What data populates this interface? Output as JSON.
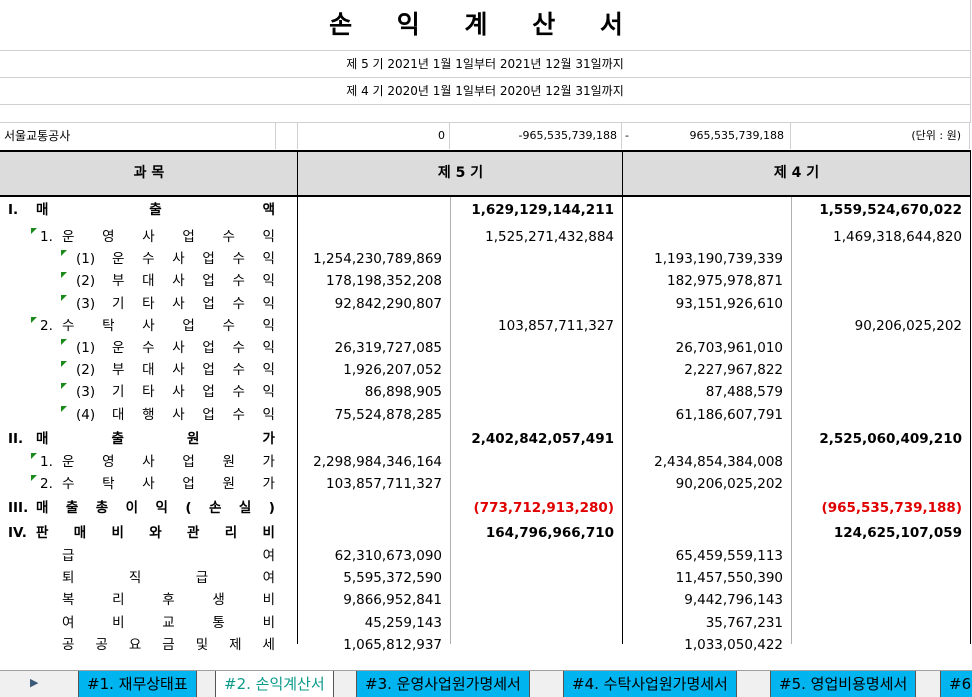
{
  "title": "손 익 계 산 서",
  "period_current": "제 5 기   2021년 1월 1일부터 2021년 12월 31일까지",
  "period_prior": "제 4 기   2020년 1월 1일부터 2020년 12월 31일까지",
  "info": {
    "company": "서울교통공사",
    "val1": "0",
    "val2": "-965,535,739,188",
    "dash": "-",
    "val3": "965,535,739,188",
    "unit": "(단위 : 원)"
  },
  "header": {
    "subject": "과          목",
    "current": "제 5 기",
    "prior": "제 4 기"
  },
  "rows": [
    {
      "num": "I.",
      "label": "매출액",
      "c1": "",
      "c2": "1,629,129,144,211",
      "c3": "",
      "c4": "1,559,524,670,022",
      "major": true
    },
    {
      "num": "1.",
      "label": "운영사업수익",
      "c1": "",
      "c2": "1,525,271,432,884",
      "c3": "",
      "c4": "1,469,318,644,820",
      "ind": 1
    },
    {
      "num": "(1)",
      "label": "운수사업수익",
      "c1": "1,254,230,789,869",
      "c2": "",
      "c3": "1,193,190,739,339",
      "c4": "",
      "ind": 2
    },
    {
      "num": "(2)",
      "label": "부대사업수익",
      "c1": "178,198,352,208",
      "c2": "",
      "c3": "182,975,978,871",
      "c4": "",
      "ind": 2
    },
    {
      "num": "(3)",
      "label": "기타사업수익",
      "c1": "92,842,290,807",
      "c2": "",
      "c3": "93,151,926,610",
      "c4": "",
      "ind": 2
    },
    {
      "num": "2.",
      "label": "수탁사업수익",
      "c1": "",
      "c2": "103,857,711,327",
      "c3": "",
      "c4": "90,206,025,202",
      "ind": 1
    },
    {
      "num": "(1)",
      "label": "운수사업수익",
      "c1": "26,319,727,085",
      "c2": "",
      "c3": "26,703,961,010",
      "c4": "",
      "ind": 2
    },
    {
      "num": "(2)",
      "label": "부대사업수익",
      "c1": "1,926,207,052",
      "c2": "",
      "c3": "2,227,967,822",
      "c4": "",
      "ind": 2
    },
    {
      "num": "(3)",
      "label": "기타사업수익",
      "c1": "86,898,905",
      "c2": "",
      "c3": "87,488,579",
      "c4": "",
      "ind": 2
    },
    {
      "num": "(4)",
      "label": "대행사업수익",
      "c1": "75,524,878,285",
      "c2": "",
      "c3": "61,186,607,791",
      "c4": "",
      "ind": 2
    },
    {
      "num": "II.",
      "label": "매출원가",
      "c1": "",
      "c2": "2,402,842,057,491",
      "c3": "",
      "c4": "2,525,060,409,210",
      "major": true
    },
    {
      "num": "1.",
      "label": "운영사업원가",
      "c1": "2,298,984,346,164",
      "c2": "",
      "c3": "2,434,854,384,008",
      "c4": "",
      "ind": 1
    },
    {
      "num": "2.",
      "label": "수탁사업원가",
      "c1": "103,857,711,327",
      "c2": "",
      "c3": "90,206,025,202",
      "c4": "",
      "ind": 1
    },
    {
      "num": "III.",
      "label": "매출총이익(손실)",
      "c1": "",
      "c2": "(773,712,913,280)",
      "c3": "",
      "c4": "(965,535,739,188)",
      "major": true,
      "neg": true
    },
    {
      "num": "IV.",
      "label": "판매비와관리비",
      "c1": "",
      "c2": "164,796,966,710",
      "c3": "",
      "c4": "124,625,107,059",
      "major": true
    },
    {
      "num": "",
      "label": "급여",
      "c1": "62,310,673,090",
      "c2": "",
      "c3": "65,459,559,113",
      "c4": "",
      "ind": 3
    },
    {
      "num": "",
      "label": "퇴직급여",
      "c1": "5,595,372,590",
      "c2": "",
      "c3": "11,457,550,390",
      "c4": "",
      "ind": 3
    },
    {
      "num": "",
      "label": "복리후생비",
      "c1": "9,866,952,841",
      "c2": "",
      "c3": "9,442,796,143",
      "c4": "",
      "ind": 3
    },
    {
      "num": "",
      "label": "여비교통비",
      "c1": "45,259,143",
      "c2": "",
      "c3": "35,767,231",
      "c4": "",
      "ind": 3
    },
    {
      "num": "",
      "label": "공공요금및제세",
      "c1": "1,065,812,937",
      "c2": "",
      "c3": "1,033,050,422",
      "c4": "",
      "ind": 3
    }
  ],
  "tabs": [
    "#1. 재무상태표",
    "#2. 손익계산서",
    "#3. 운영사업원가명세서",
    "#4. 수탁사업원가명세서",
    "#5. 영업비용명세서",
    "#6"
  ],
  "active_tab": 1,
  "icons": {
    "nav_next": "triangle-right"
  },
  "colors": {
    "negative": "#e00000",
    "header_bg": "#dcdcdc",
    "tab_bg": "#00b4f0",
    "active_tab_text": "#0a9a8a",
    "comment_marker": "#1a8a1a"
  }
}
